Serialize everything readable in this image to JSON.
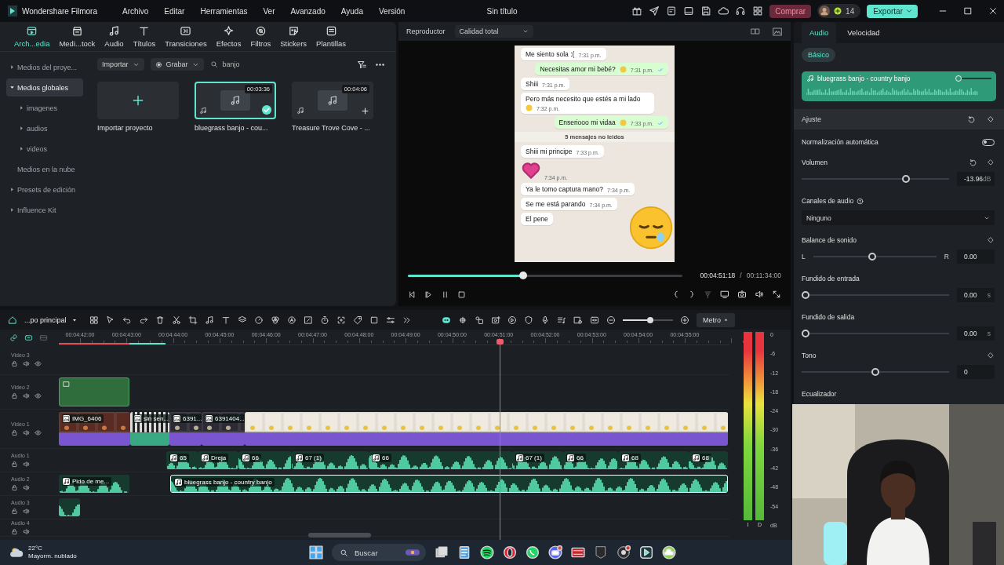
{
  "window": {
    "app_name": "Wondershare Filmora",
    "title": "Sin título"
  },
  "menu": [
    "Archivo",
    "Editar",
    "Herramientas",
    "Ver",
    "Avanzado",
    "Ayuda",
    "Versión"
  ],
  "header": {
    "buy_button": "Comprar",
    "credits": "14",
    "export_button": "Exportar"
  },
  "media_tabs": [
    {
      "label": "Arch...edia",
      "selected": true
    },
    {
      "label": "Medi...tock",
      "selected": false
    },
    {
      "label": "Audio",
      "selected": false
    },
    {
      "label": "Títulos",
      "selected": false
    },
    {
      "label": "Transiciones",
      "selected": false
    },
    {
      "label": "Efectos",
      "selected": false
    },
    {
      "label": "Filtros",
      "selected": false
    },
    {
      "label": "Stickers",
      "selected": false
    },
    {
      "label": "Plantillas",
      "selected": false
    }
  ],
  "media_sidebar": [
    {
      "kind": "group",
      "label": "Medios del proye...",
      "selected": false,
      "expanded": false
    },
    {
      "kind": "group",
      "label": "Medios globales",
      "selected": true,
      "expanded": true,
      "children": [
        {
          "kind": "group",
          "label": "imagenes",
          "selected": false,
          "expanded": false
        },
        {
          "kind": "group",
          "label": "audios",
          "selected": false,
          "expanded": false
        },
        {
          "kind": "group",
          "label": "videos",
          "selected": false,
          "expanded": false
        }
      ]
    },
    {
      "kind": "link",
      "label": "Medios en la nube",
      "selected": false
    },
    {
      "kind": "group",
      "label": "Presets de edición",
      "selected": false,
      "expanded": false
    },
    {
      "kind": "group",
      "label": "Influence Kit",
      "selected": false,
      "expanded": false
    }
  ],
  "media_toolbar": {
    "import": "Importar",
    "record": "Grabar",
    "search": "banjo"
  },
  "media_items": [
    {
      "kind": "import",
      "label": "Importar proyecto"
    },
    {
      "kind": "audio",
      "label": "bluegrass banjo - cou...",
      "duration": "00:03:36",
      "selected": true
    },
    {
      "kind": "audio",
      "label": "Treasure Trove Cove - ...",
      "duration": "00:04:06",
      "selected": false
    }
  ],
  "player": {
    "title": "Reproductor",
    "quality": "Calidad total",
    "level": 0.42,
    "current_time": "00:04:51:18",
    "separator": "/",
    "total_time": "00:11:34:00",
    "chat": [
      {
        "kind": "in",
        "text": "Me siento sola :(",
        "time": "7:31 p.m."
      },
      {
        "kind": "out",
        "text": "Necesitas amor mi bebé?",
        "time": "7:31 p.m.",
        "emoji": true
      },
      {
        "kind": "in",
        "text": "Shiii",
        "time": "7:31 p.m."
      },
      {
        "kind": "in",
        "text": "Pero más necesito que estés a mi lado",
        "time": "7:32 p.m.",
        "emoji": true
      },
      {
        "kind": "out",
        "text": "Enseriooo mi vidaa",
        "time": "7:33 p.m.",
        "emoji": true
      },
      {
        "kind": "divider",
        "text": "5 mensajes no leidos"
      },
      {
        "kind": "in",
        "text": "Shiii mi principe",
        "time": "7:33 p.m."
      },
      {
        "kind": "sticker",
        "time": "7:34 p.m."
      },
      {
        "kind": "in",
        "text": "Ya le tomo captura mano?",
        "time": "7:34 p.m."
      },
      {
        "kind": "in",
        "text": "Se me está parando",
        "time": "7:34 p.m."
      },
      {
        "kind": "in",
        "text": "El pene"
      }
    ]
  },
  "properties": {
    "tabs": [
      {
        "label": "Audio",
        "selected": true
      },
      {
        "label": "Velocidad",
        "selected": false
      }
    ],
    "mode": "Básico",
    "clip": {
      "label": "bluegrass banjo - country banjo",
      "level": 0
    },
    "section": "Ajuste",
    "rows": [
      {
        "kind": "toggle",
        "label": "Normalización automática",
        "on": false
      },
      {
        "kind": "slider",
        "label": "Volumen",
        "level": 0.72,
        "value": "-13.96",
        "unit": "dB",
        "reset": true,
        "keyframe": true
      },
      {
        "kind": "dropdown",
        "label": "Canales de audio",
        "help": true,
        "value": "Ninguno"
      },
      {
        "kind": "balance",
        "label": "Balance de sonido",
        "left": "L",
        "right": "R",
        "level": 0.48,
        "value": "0.00",
        "keyframe": true
      },
      {
        "kind": "slider",
        "label": "Fundido de entrada",
        "level": 0,
        "value": "0.00",
        "unit": "s"
      },
      {
        "kind": "slider",
        "label": "Fundido  de salida",
        "level": 0,
        "value": "0.00",
        "unit": "s"
      },
      {
        "kind": "slider",
        "label": "Tono",
        "level": 0.5,
        "value": "0",
        "keyframe": true
      },
      {
        "kind": "heading",
        "label": "Ecualizador"
      }
    ]
  },
  "timeline": {
    "sequence": "...po principal",
    "meter_button": "Metro",
    "zoom": {
      "level": 0.54
    },
    "ruler": [
      "00:04:42:00",
      "00:04:43:00",
      "00:04:44:00",
      "00:04:45:00",
      "00:04:46:00",
      "00:04:47:00",
      "00:04:48:00",
      "00:04:49:00",
      "00:04:50:00",
      "00:04:51:00",
      "00:04:52:00",
      "00:04:53:00",
      "00:04:54:00",
      "00:04:55:00"
    ],
    "tracks": [
      {
        "kind": "video",
        "name": "Video 3"
      },
      {
        "kind": "video",
        "name": "Video 2",
        "clips": [
          {
            "kind": "green"
          }
        ]
      },
      {
        "kind": "video",
        "name": "Video 1",
        "clips": [
          {
            "kind": "film",
            "label": "IMG_6406"
          },
          {
            "kind": "striped",
            "label": "sin sen..."
          },
          {
            "label": "6391..."
          },
          {
            "label": "6391404..."
          },
          {
            "kind": "chat"
          }
        ]
      },
      {
        "kind": "audio",
        "name": "Audio 1",
        "clips": [
          {
            "kind": "audio",
            "label": "65"
          },
          {
            "kind": "audio",
            "label": "Dreja"
          },
          {
            "kind": "audio",
            "label": "66"
          },
          {
            "kind": "audio",
            "label": "67 (1)"
          },
          {
            "kind": "audio",
            "label": "66"
          },
          {
            "kind": "audio",
            "label": "67 (1)"
          },
          {
            "kind": "audio",
            "label": "66"
          },
          {
            "kind": "audio",
            "label": "68"
          },
          {
            "kind": "audio",
            "label": "68"
          }
        ]
      },
      {
        "kind": "audio",
        "name": "Audio 2",
        "clips": [
          {
            "kind": "audio",
            "label": "Pido de me...",
            "selected": false
          },
          {
            "kind": "audio",
            "label": "bluegrass banjo - country banjo",
            "selected": true
          }
        ]
      },
      {
        "kind": "audio",
        "name": "Audio 3",
        "clips": [
          {
            "kind": "audio"
          }
        ]
      },
      {
        "kind": "audio",
        "name": "Audio 4"
      }
    ],
    "meter": {
      "scale": [
        "0",
        "-6",
        "-12",
        "-18",
        "-24",
        "-30",
        "-36",
        "-42",
        "-48",
        "-54",
        "dB"
      ],
      "channels": [
        {
          "label": "I",
          "level": 1
        },
        {
          "label": "D",
          "level": 1
        }
      ]
    }
  },
  "taskbar": {
    "temperature": "22°C",
    "weather": "Mayorm. nublado",
    "search_placeholder": "Buscar"
  },
  "webcam": {
    "kind": "picture"
  }
}
